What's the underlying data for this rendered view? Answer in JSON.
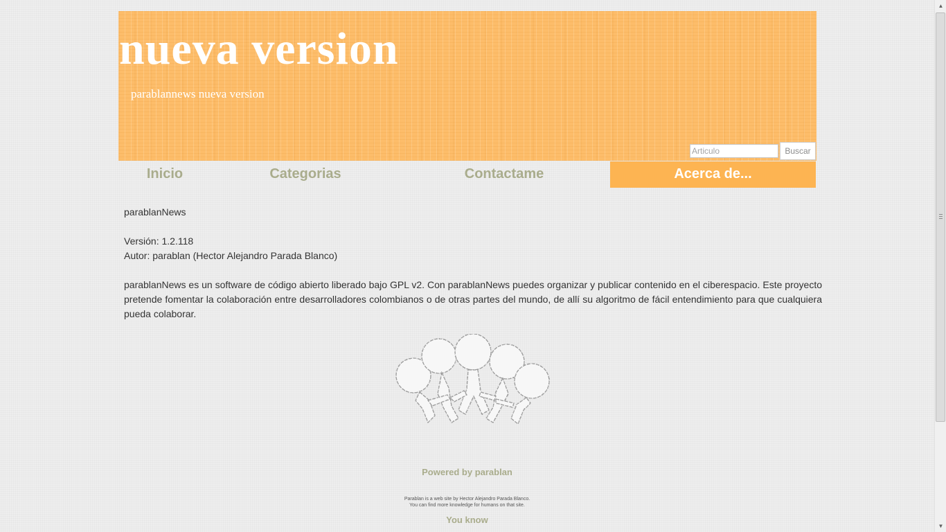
{
  "header": {
    "title": "nueva version",
    "subtitle": "parablannews nueva version",
    "background_color": "#fdbd6a"
  },
  "search": {
    "placeholder": "Articulo",
    "value": "",
    "button_label": "Buscar"
  },
  "nav": {
    "items": [
      {
        "label": "Inicio",
        "active": false
      },
      {
        "label": "Categorias",
        "active": false
      },
      {
        "label": "Contactame",
        "active": false
      },
      {
        "label": "Acerca de...",
        "active": true
      }
    ],
    "text_color": "#a9ac8c",
    "active_color": "#fdb452"
  },
  "content": {
    "name": "parablanNews",
    "version": "Versión: 1.2.118",
    "author": "Autor: parablan (Hector Alejandro Parada Blanco)",
    "description": "parablanNews es un software de código abierto liberado bajo GPL v2. Con parablanNews puedes organizar y publicar contenido en el ciberespacio. Este proyecto pretende fomentar la colaboración entre desarrolladores colombianos o de otras partes del mundo, de allí su algoritmo de fácil entendimiento para que cualquiera pueda colaborar."
  },
  "logo": {
    "icon": "people-holding-hands-icon"
  },
  "footer": {
    "powered_by": "Powered by parablan",
    "note_line1": "Parablan is a web site by Hector Alejandro Parada Blanco.",
    "note_line2": "You can find more knowledge for humans on that site.",
    "you_know": "You know"
  }
}
